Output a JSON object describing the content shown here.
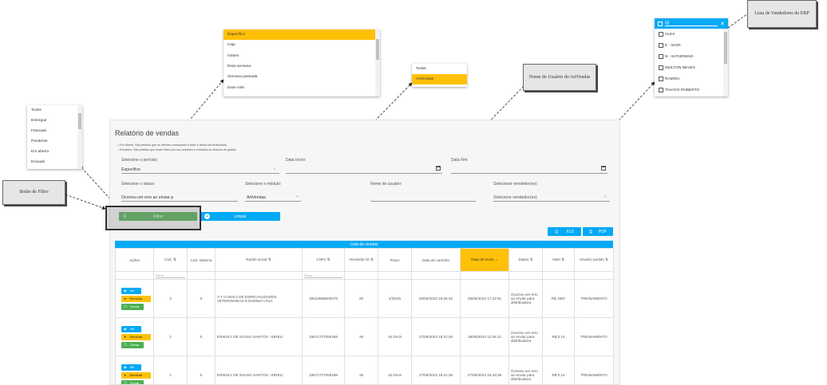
{
  "report": {
    "title": "Relatório de vendas",
    "notes": [
      "Em Aberto: São pedidos que os clientes começaram a fazer e ainda não finalizaram.",
      "Enviados: São pedidos que foram feitos por um vendedor e enviados ao sistema de gestão."
    ],
    "period_label": "Selecione o período:",
    "period_value": "Específico",
    "date_start_label": "Data Início:",
    "date_end_label": "Data Fim:",
    "status_label": "Selecione o status:",
    "status_value": "Ocorreu um erro ao enviar p",
    "module_label": "Selecione o módulo:",
    "module_value": "ArtVendas",
    "username_label": "Nome do usuário:",
    "sellers_label": "Selecionar vendedor(es):",
    "sellers_value": "Selecione vendedor(es)",
    "filter_button": "Filtrar",
    "clear_button": "Limpar",
    "xls_button": "XLS",
    "pdf_button": "PDF"
  },
  "table": {
    "header": "Lista de vendas",
    "columns": [
      "Ações",
      "Cód.",
      "Cód. sistema",
      "Razão social",
      "CNPJ",
      "Vendedor ID",
      "Prazo",
      "Data do carrinho",
      "Data de envio",
      "Status",
      "Valor",
      "Usuário pedido"
    ],
    "filter_placeholder": "Filtrar...",
    "actions": {
      "view": "Ver",
      "resend": "Reenviar",
      "clone": "Clonar"
    },
    "rows": [
      {
        "cod": "3",
        "cod_sistema": "0",
        "razao": "A T CLINICA DE ESPECIALIDADES VETERINARIAS E ENSINO LTDA",
        "cnpj": "28813568000275",
        "vendedor": "26",
        "prazo": "1/30/45",
        "data_carrinho": "26/06/2023 16:25:42",
        "data_envio": "28/06/2023 17:22:01",
        "status": "Ocorreu um erro ao enviar para distribuidora",
        "valor": "R$ 1957",
        "usuario": "TREINAMENTO"
      },
      {
        "cod": "2",
        "cod_sistema": "0",
        "razao": "ERIESLY DE SOUSA SANTOS - EIRELI",
        "cnpj": "33571727000188",
        "vendedor": "26",
        "prazo": "15 DIAS",
        "data_carrinho": "27/06/2023 15:47:46",
        "data_envio": "28/06/2023 11:46:12",
        "status": "Ocorreu um erro ao enviar para distribuidora",
        "valor": "R$ 0.14",
        "usuario": "TREINAMENTO"
      },
      {
        "cod": "1",
        "cod_sistema": "0",
        "razao": "ERIESLY DE SOUSA SANTOS - EIRELI",
        "cnpj": "33571727000188",
        "vendedor": "26",
        "prazo": "15 DIAS",
        "data_carrinho": "27/06/2023 16:41:26",
        "data_envio": "27/06/2023 16:43:39",
        "status": "Ocorreu um erro ao enviar para distribuidora",
        "valor": "R$ 0.14",
        "usuario": "TREINAMENTO"
      }
    ]
  },
  "dropdowns": {
    "status_options": [
      "Todos",
      "Entregue",
      "Faturado",
      "Pendente",
      "Em aberto",
      "Enviado"
    ],
    "period_options": [
      "Específico",
      "Hoje",
      "Ontem",
      "Essa semana",
      "Semana passada",
      "Esse mês"
    ],
    "period_selected": "Específico",
    "module_options": [
      "Todos",
      "ArtVendas"
    ],
    "module_selected": "ArtVendas",
    "vendor_search": "Q|",
    "vendor_options": [
      "ALEX",
      "E - IGOR",
      "N - SATURNINO",
      "NEILTON NEVES",
      "RAMON",
      "THIAGO ROBERTO"
    ]
  },
  "callouts": {
    "filter_button": "Botão de Filtro",
    "user_name": "Nome do Usuário do ArtVendas",
    "vendor_list": "Lista de Vendedores do ERP"
  },
  "colors": {
    "accent_blue": "#03a9f4",
    "accent_yellow": "#ffc107",
    "accent_green": "#4caf50"
  }
}
